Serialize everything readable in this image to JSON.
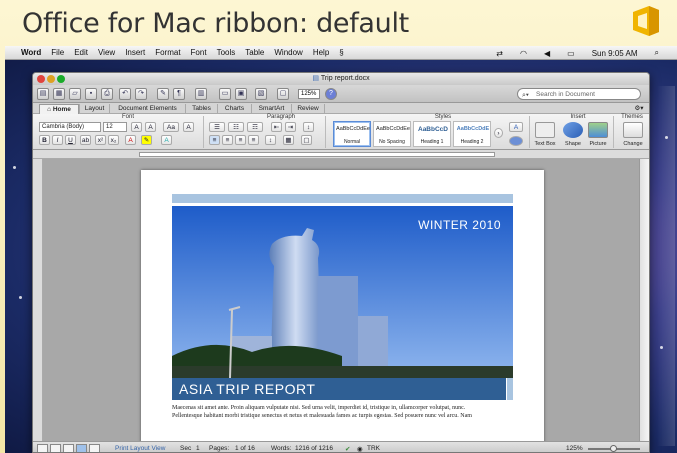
{
  "slide": {
    "title": "Office for Mac ribbon: default"
  },
  "menubar": {
    "items": [
      "Word",
      "File",
      "Edit",
      "View",
      "Insert",
      "Format",
      "Font",
      "Tools",
      "Table",
      "Window",
      "Help"
    ],
    "clock": "Sun 9:05 AM"
  },
  "window": {
    "title": "Trip report.docx",
    "zoom": "125%",
    "search_placeholder": "Search in Document"
  },
  "ribbon": {
    "tabs": [
      "Home",
      "Layout",
      "Document Elements",
      "Tables",
      "Charts",
      "SmartArt",
      "Review"
    ],
    "groups": [
      "Font",
      "Paragraph",
      "Styles",
      "Insert",
      "Themes"
    ],
    "font_name": "Cambria (Body)",
    "font_size": "12",
    "styles": [
      {
        "sample": "AaBbCcDdEe",
        "label": "Normal"
      },
      {
        "sample": "AaBbCcDdEe",
        "label": "No Spacing"
      },
      {
        "sample": "AaBbCcD",
        "label": "Heading 1"
      },
      {
        "sample": "AaBbCcDdE",
        "label": "Heading 2"
      }
    ],
    "insert_buttons": [
      "Text Box",
      "Shape",
      "Picture"
    ],
    "themes_button": "Change"
  },
  "document": {
    "season": "WINTER 2010",
    "report_title": "ASIA TRIP REPORT",
    "body_lines": [
      "Maecenas sit amet ante. Proin aliquam vulputate nisi. Sed urna velit, imperdiet id, tristique in, ullamcorper volutpat, nunc.",
      "Pellentesque habitant morbi tristique senectus et netus et malesuada fames ac turpis egestas. Sed posuere nunc vel arcu. Nam"
    ]
  },
  "statusbar": {
    "view_label": "Print Layout View",
    "sec_label": "Sec",
    "sec_value": "1",
    "pages_label": "Pages:",
    "pages_value": "1 of 16",
    "words_label": "Words:",
    "words_value": "1216 of 1216",
    "trk": "TRK",
    "zoom": "125%"
  },
  "colors": {
    "accent_blue": "#2f5f94",
    "light_blue": "#a8c4e0",
    "office_orange": "#f0b400"
  }
}
